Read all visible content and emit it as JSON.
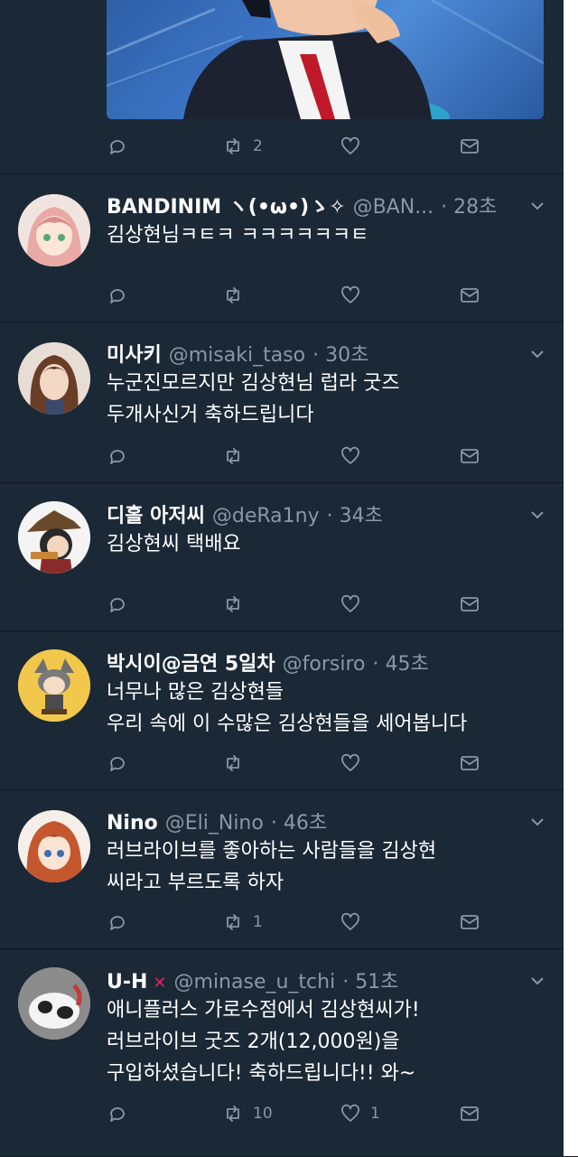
{
  "colors": {
    "background": "#1b2836",
    "secondary_text": "#8899a6",
    "divider": "#0e151d"
  },
  "media_tweet": {
    "image_label": "photo-of-man-in-suit-with-red-tie",
    "actions": {
      "reply": "",
      "retweet": "2",
      "like": "",
      "dm": ""
    }
  },
  "tweets": [
    {
      "name": "BANDINIM ヽ(•ω•)ゝ✧",
      "handle": "@BAN...",
      "time": "· 28초",
      "lines": [
        "김상현님ㅋㅌㅋ ㅋㅋㅋㅋㅋㅋㅌ"
      ],
      "actions": {
        "reply": "",
        "retweet": "",
        "like": "",
        "dm": ""
      },
      "avatar_icon": "anime-girl-avatar"
    },
    {
      "name": "미사키",
      "handle": "@misaki_taso",
      "time": "· 30초",
      "lines": [
        "누군진모르지만 김상현님 럽라 굿즈",
        "두개사신거 축하드립니다"
      ],
      "actions": {
        "reply": "",
        "retweet": "",
        "like": "",
        "dm": ""
      },
      "avatar_icon": "woman-photo-avatar"
    },
    {
      "name": "디홀 아저씨",
      "handle": "@deRa1ny",
      "time": "· 34초",
      "lines": [
        "김상현씨 택배요"
      ],
      "actions": {
        "reply": "",
        "retweet": "",
        "like": "",
        "dm": ""
      },
      "avatar_icon": "hat-character-avatar"
    },
    {
      "name": "박시이@금연 5일차",
      "handle": "@forsiro",
      "time": "· 45초",
      "lines": [
        "너무나 많은 김상현들",
        "우리 속에 이 수많은 김상현들을 세어봅니다"
      ],
      "actions": {
        "reply": "",
        "retweet": "",
        "like": "",
        "dm": ""
      },
      "avatar_icon": "raccoon-girl-avatar"
    },
    {
      "name": "Nino",
      "handle": "@Eli_Nino",
      "time": "· 46초",
      "lines": [
        "러브라이브를 좋아하는 사람들을 김상현",
        "씨라고 부르도록 하자"
      ],
      "actions": {
        "reply": "",
        "retweet": "1",
        "like": "",
        "dm": ""
      },
      "avatar_icon": "red-hair-girl-avatar"
    },
    {
      "name": "U-H",
      "name_badge": "✕",
      "handle": "@minase_u_tchi",
      "time": "· 51초",
      "lines": [
        "애니플러스 가로수점에서 김상현씨가!",
        "러브라이브 굿즈 2개(12,000원)을",
        "구입하셨습니다! 축하드립니다!! 와~"
      ],
      "actions": {
        "reply": "",
        "retweet": "10",
        "like": "1",
        "dm": ""
      },
      "avatar_icon": "cat-photo-avatar"
    }
  ]
}
